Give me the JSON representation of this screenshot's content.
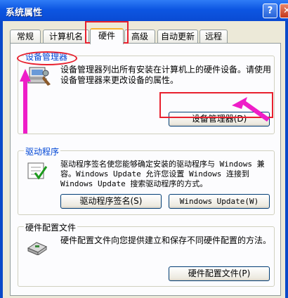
{
  "window": {
    "title": "系统属性",
    "help": "?",
    "close": "✕"
  },
  "tabs": [
    {
      "label": "常规"
    },
    {
      "label": "计算机名"
    },
    {
      "label": "硬件"
    },
    {
      "label": "高级"
    },
    {
      "label": "自动更新"
    },
    {
      "label": "远程"
    }
  ],
  "device_manager": {
    "title": "设备管理器",
    "description": "设备管理器列出所有安装在计算机上的硬件设备。请使用设备管理器来更改设备的属性。",
    "button": "设备管理器(D)"
  },
  "drivers": {
    "title": "驱动程序",
    "description": "驱动程序签名使您能够确定安装的驱动程序与 Windows 兼容。Windows Update 允许您设置 Windows 连接到 Windows Update 搜索驱动程序的方式。",
    "signing_button": "驱动程序签名(S)",
    "update_button": "Windows Update(W)"
  },
  "hardware_profiles": {
    "title": "硬件配置文件",
    "description": "硬件配置文件向您提供建立和保存不同硬件配置的方法。",
    "button": "硬件配置文件(P)"
  },
  "colors": {
    "annotation": "#e8202e",
    "arrow": "#ee1ec8",
    "titlebar": "#0d56e2"
  }
}
